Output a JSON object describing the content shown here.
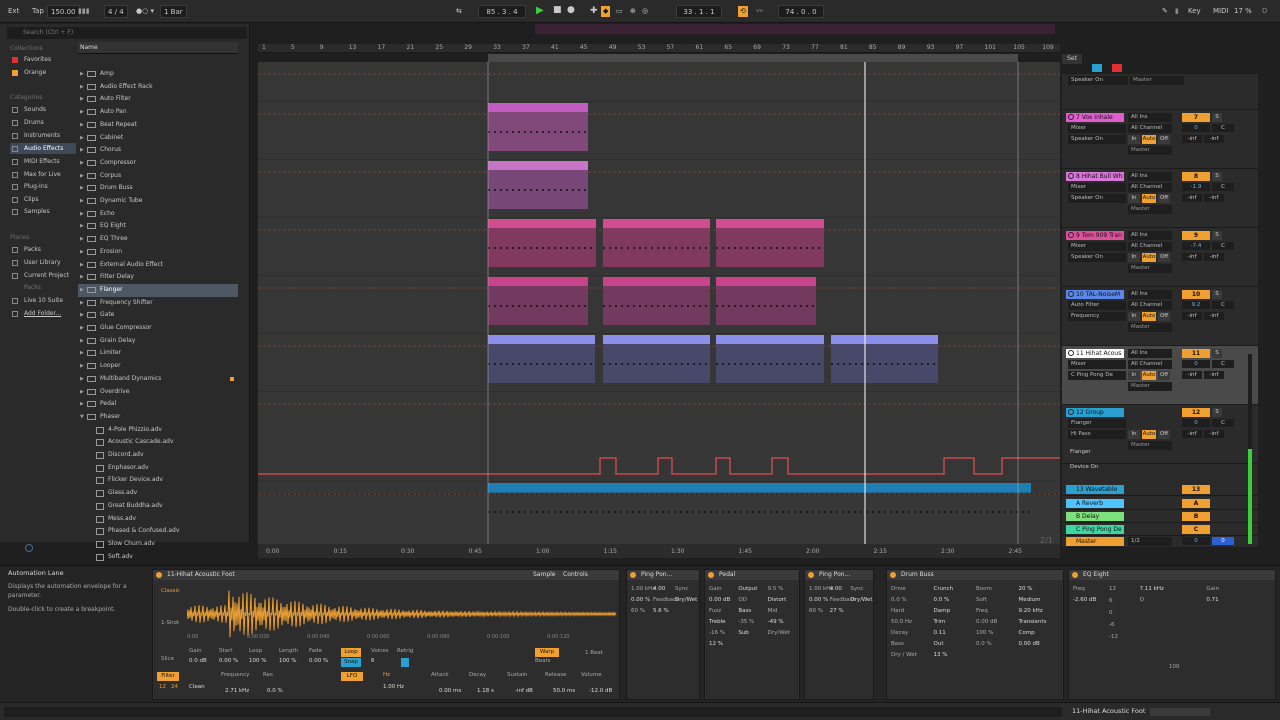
{
  "topbar": {
    "ext": "Ext",
    "tap": "Tap",
    "tempo": "150.00",
    "sig": "4 / 4",
    "bar": "1 Bar",
    "pos": "85 . 3 . 4",
    "loop_start": "33 . 1 . 1",
    "loop_len": "74 . 0 . 0",
    "key": "Key",
    "midi": "MIDI",
    "cpu": "17 %",
    "d": "D"
  },
  "browser": {
    "search_placeholder": "Search (Ctrl + F)",
    "collections_hdr": "Collections",
    "favorites": "Favorites",
    "orange": "Orange",
    "categories_hdr": "Categories",
    "sounds": "Sounds",
    "drums": "Drums",
    "instruments": "Instruments",
    "audio_effects": "Audio Effects",
    "midi_effects": "MIDI Effects",
    "max_for_live": "Max for Live",
    "plugins": "Plug-Ins",
    "clips": "Clips",
    "samples": "Samples",
    "places_hdr": "Places",
    "packs": "Packs",
    "user_library": "User Library",
    "current_project": "Current Project",
    "packs2": "Packs",
    "live10": "Live 10 Suite",
    "add_folder": "Add Folder...",
    "name_hdr": "Name",
    "items": [
      "Amp",
      "Audio Effect Rack",
      "Auto Filter",
      "Auto Pan",
      "Beat Repeat",
      "Cabinet",
      "Chorus",
      "Compressor",
      "Corpus",
      "Drum Buss",
      "Dynamic Tube",
      "Echo",
      "EQ Eight",
      "EQ Three",
      "Erosion",
      "External Audio Effect",
      "Filter Delay",
      "Flanger",
      "Frequency Shifter",
      "Gate",
      "Glue Compressor",
      "Grain Delay",
      "Limiter",
      "Looper",
      "Multiband Dynamics",
      "Overdrive",
      "Pedal",
      "Phaser"
    ],
    "children": [
      "4-Pole Phizzio.adv",
      "Acoustic Cascade.adv",
      "Discord.adv",
      "Enphasor.adv",
      "Flicker Device.adv",
      "Glass.adv",
      "Great Buddha.adv",
      "Mess.adv",
      "Phased & Confused.adv",
      "Slow Churn.adv",
      "Soft.adv"
    ]
  },
  "ruler": {
    "bars": [
      "1",
      "5",
      "9",
      "13",
      "17",
      "21",
      "25",
      "29",
      "33",
      "37",
      "41",
      "45",
      "49",
      "53",
      "57",
      "61",
      "65",
      "69",
      "73",
      "77",
      "81",
      "85",
      "89",
      "93",
      "97",
      "101",
      "105",
      "109"
    ],
    "times": [
      "0:00",
      "0:15",
      "0:30",
      "0:45",
      "1:00",
      "1:15",
      "1:30",
      "1:45",
      "2:00",
      "2:15",
      "2:30",
      "2:45"
    ],
    "zoom": "2/1"
  },
  "mixer": {
    "set": "Set",
    "tracks": [
      {
        "num": "7",
        "name": "7 Vox Inhale",
        "in": "All Ins",
        "mon": "Mixer",
        "out": "Speaker On",
        "ch": "All Channel",
        "dest": "Master",
        "vol": "0",
        "pan": "C",
        "color": "#e05cd0"
      },
      {
        "num": "8",
        "name": "8 Hihat Bull Wh",
        "in": "All Ins",
        "mon": "Mixer",
        "out": "Speaker On",
        "ch": "All Channel",
        "dest": "Master",
        "vol": "-1.9",
        "pan": "C",
        "color": "#d877d8"
      },
      {
        "num": "9",
        "name": "9 Tom 909 Tran",
        "in": "All Ins",
        "mon": "Mixer",
        "out": "Speaker On",
        "ch": "All Channel",
        "dest": "Master",
        "vol": "-7.4",
        "pan": "C",
        "color": "#e04e9c"
      },
      {
        "num": "10",
        "name": "10 TAL-NoiseM",
        "in": "All Ins",
        "mon": "Auto Filter",
        "out": "Frequency",
        "ch": "All Channel",
        "dest": "Master",
        "vol": "9.2",
        "pan": "C",
        "color": "#5a87e8"
      },
      {
        "num": "11",
        "name": "11 Hihat Acous",
        "in": "All Ins",
        "mon": "Mixer",
        "out": "C Ping Pong De",
        "ch": "All Channel",
        "dest": "Master",
        "vol": "0",
        "pan": "C",
        "color": "#ffffff"
      },
      {
        "num": "12",
        "name": "12 Group",
        "in": "",
        "mon": "Flanger",
        "out": "Hi Pass",
        "ch": "",
        "dest": "Master",
        "vol": "0",
        "pan": "C",
        "color": "#2aa0d0"
      }
    ],
    "group_label": "Flanger",
    "group_label2": "Device On",
    "wavetable": "13 Wavetable",
    "wavetable_num": "13",
    "returns": [
      {
        "name": "A Reverb",
        "num": "A",
        "color": "#4fc3ff"
      },
      {
        "name": "B Delay",
        "num": "B",
        "color": "#7de07d"
      },
      {
        "name": "C Ping Pong De",
        "num": "C",
        "color": "#3cd6a0"
      }
    ],
    "master": {
      "name": "Master",
      "sel": "1/2",
      "vol": "0",
      "pan": "0"
    },
    "top_send": "Speaker On",
    "top_dest": "Master",
    "inf": "-inf",
    "in_lbl": "In",
    "auto_lbl": "Auto",
    "off_lbl": "Off",
    "s_lbl": "S",
    "track11_val": "-15.5"
  },
  "info": {
    "title": "Automation Lane",
    "text1": "Displays the automation envelope for a parameter.",
    "text2": "Double-click to create a breakpoint."
  },
  "clipview": {
    "title": "11-Hihat Acoustic Foot",
    "sample": "Sample",
    "controls": "Controls",
    "gain": "Gain",
    "gain_v": "0.0 dB",
    "start": "Start",
    "start_v": "0.00 %",
    "loop": "Loop",
    "loop_v": "100 %",
    "length": "Length",
    "length_v": "100 %",
    "fade": "Fade",
    "fade_v": "0.00 %",
    "loop_btn": "Loop",
    "snap_btn": "Snap",
    "voices": "Voices",
    "voices_v": "6",
    "retrig": "Retrig",
    "warp": "Warp",
    "beats": "Beats",
    "one_beat": "1 Beat",
    "times": [
      "0:00",
      "0:00:020",
      "0:00:040",
      "0:00:060",
      "0:00:080",
      "0:00:100",
      "0:00:120"
    ],
    "classic": "Classic",
    "one_shot": "1-Shot",
    "slice": "Slice",
    "filter": "Filter",
    "lfo": "LFO",
    "freq": "Frequency",
    "freq_v": "2.71 kHz",
    "res": "Res",
    "res_v": "0.0 %",
    "lfo_v": "1.00 Hz",
    "attack": "Attack",
    "attack_v": "0.00 ms",
    "decay": "Decay",
    "decay_v": "1.18 s",
    "sustain": "Sustain",
    "sustain_v": "-inf dB",
    "release": "Release",
    "release_v": "50.0 ms",
    "volume": "Volume",
    "volume_v": "-12.0 dB",
    "clean": "Clean",
    "f12": "12",
    "f24": "24",
    "hz": "Hz"
  },
  "devices": [
    {
      "name": "Ping Pon...",
      "labels": [
        "1.00 kHz",
        "4.00",
        "Sync",
        "0.00 %",
        "Feedback",
        "Dry/Wet",
        "60 %",
        "5.6 %"
      ]
    },
    {
      "name": "Pedal",
      "labels": [
        "Gain",
        "Output",
        "9.5 %",
        "0.00 dB",
        "OD",
        "Distort",
        "Fuzz",
        "Bass",
        "Mid",
        "Treble",
        "-35 %",
        "-49 %",
        "-16 %",
        "Sub",
        "Dry/Wet",
        "12 %"
      ]
    },
    {
      "name": "Ping Pon...",
      "labels": [
        "1.00 kHz",
        "4.00",
        "Sync",
        "0.00 %",
        "Feedback",
        "Dry/Wet",
        "60 %",
        "27 %"
      ]
    },
    {
      "name": "Drum Buss",
      "labels": [
        "Drive",
        "Crunch",
        "Boom",
        "20 %",
        "0.0 %",
        "0.0 %",
        "Soft",
        "Medium",
        "Hard",
        "Damp",
        "Freq",
        "9.20 kHz",
        "50.0 Hz",
        "Trim",
        "0.00 dB",
        "Transients",
        "Decay",
        "0.11",
        "100 %",
        "Comp",
        "Bass",
        "Out",
        "0.0 %",
        "0.00 dB",
        "Dry / Wet",
        "13 %"
      ]
    },
    {
      "name": "EQ Eight",
      "labels": [
        "Freq",
        "7.11 kHz",
        "Gain",
        "-2.60 dB",
        "Q",
        "0.71"
      ],
      "axis": [
        "12",
        "6",
        "0",
        "-6",
        "-12"
      ],
      "f100": "100"
    }
  ],
  "status": {
    "track": "11-Hihat Acoustic Foot"
  },
  "colors": {
    "accent": "#f0a030",
    "play": "#39d339"
  }
}
